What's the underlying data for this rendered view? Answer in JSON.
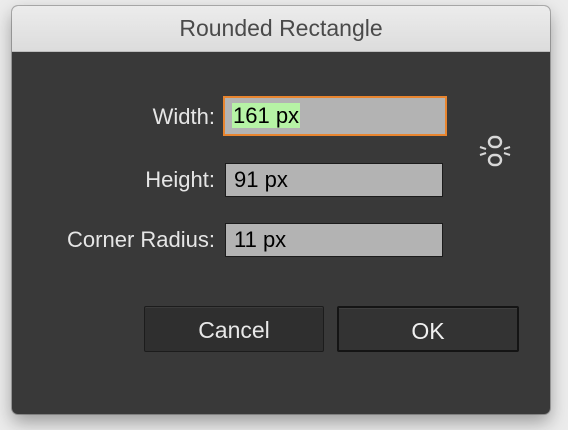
{
  "dialog": {
    "title": "Rounded Rectangle",
    "fields": {
      "width": {
        "label": "Width:",
        "value": "161 px"
      },
      "height": {
        "label": "Height:",
        "value": "91 px"
      },
      "corner_radius": {
        "label": "Corner Radius:",
        "value": "11 px"
      }
    },
    "constrain_icon": "link-icon",
    "buttons": {
      "cancel": "Cancel",
      "ok": "OK"
    }
  },
  "colors": {
    "dialog_bg": "#393939",
    "input_bg": "#b3b3b3",
    "focus_ring": "#e8852f",
    "text_selection": "#b6f3a5"
  }
}
